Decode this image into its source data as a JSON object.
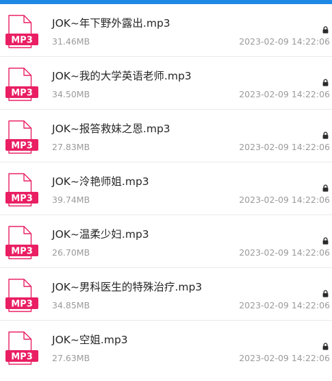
{
  "colors": {
    "accent": "#1e88e5",
    "icon": "#e91e63"
  },
  "files": [
    {
      "icon": "mp3-file-icon",
      "badge": "MP3",
      "name": "JOK~年下野外露出.mp3",
      "size": "31.46MB",
      "date": "2023-02-09 14:22:06",
      "lock": "lock-icon"
    },
    {
      "icon": "mp3-file-icon",
      "badge": "MP3",
      "name": "JOK~我的大学英语老师.mp3",
      "size": "34.50MB",
      "date": "2023-02-09 14:22:06",
      "lock": "lock-icon"
    },
    {
      "icon": "mp3-file-icon",
      "badge": "MP3",
      "name": "JOK~报答救妹之恩.mp3",
      "size": "27.83MB",
      "date": "2023-02-09 14:22:06",
      "lock": "lock-icon"
    },
    {
      "icon": "mp3-file-icon",
      "badge": "MP3",
      "name": "JOK~泠艳师姐.mp3",
      "size": "39.74MB",
      "date": "2023-02-09 14:22:06",
      "lock": "lock-icon"
    },
    {
      "icon": "mp3-file-icon",
      "badge": "MP3",
      "name": "JOK~温柔少妇.mp3",
      "size": "26.70MB",
      "date": "2023-02-09 14:22:06",
      "lock": "lock-icon"
    },
    {
      "icon": "mp3-file-icon",
      "badge": "MP3",
      "name": "JOK~男科医生的特殊治疗.mp3",
      "size": "34.85MB",
      "date": "2023-02-09 14:22:06",
      "lock": "lock-icon"
    },
    {
      "icon": "mp3-file-icon",
      "badge": "MP3",
      "name": "JOK~空姐.mp3",
      "size": "27.63MB",
      "date": "2023-02-09 14:22:06",
      "lock": "lock-icon"
    }
  ]
}
